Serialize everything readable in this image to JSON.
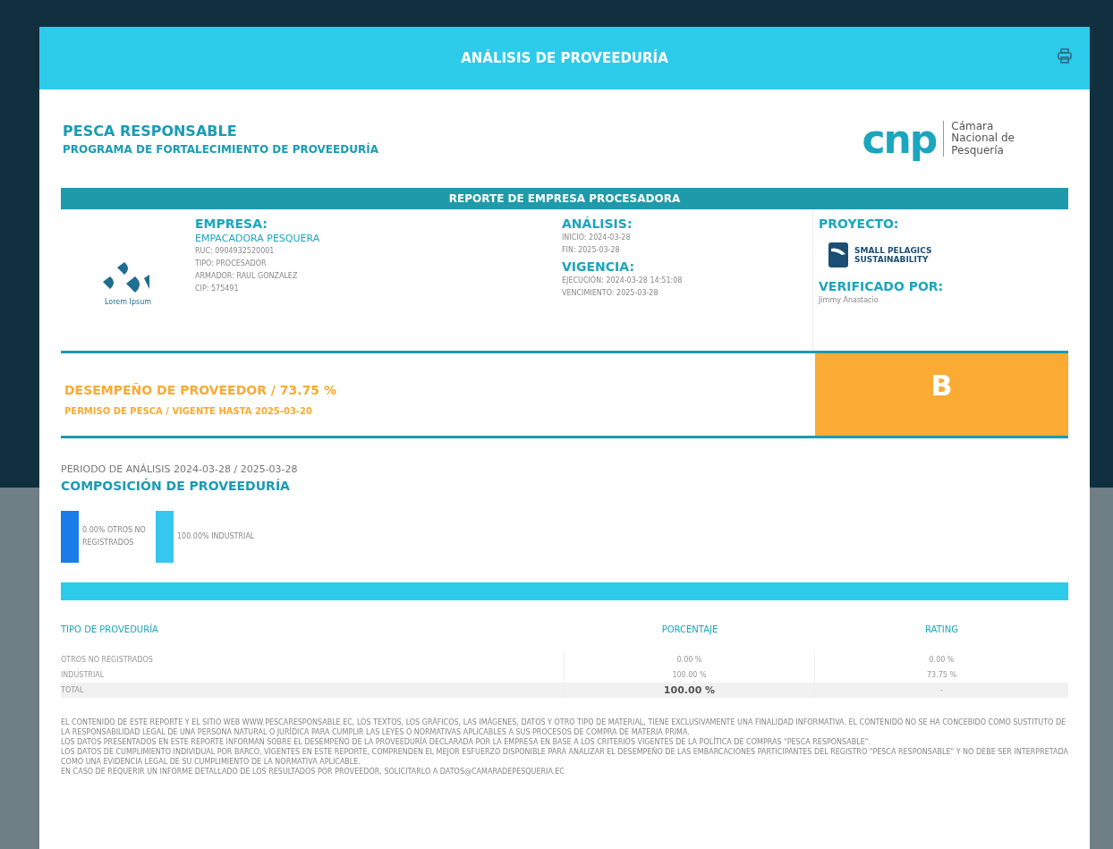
{
  "modal": {
    "title": "ANÁLISIS DE PROVEEDURÍA"
  },
  "header": {
    "title": "PESCA RESPONSABLE",
    "subtitle": "PROGRAMA DE FORTALECIMIENTO DE PROVEEDURÍA",
    "logo": {
      "mark": "cnp",
      "lines": [
        "Cámara",
        "Nacional de",
        "Pesquería"
      ]
    }
  },
  "report": {
    "title": "REPORTE DE EMPRESA PROCESADORA",
    "company_logo_text": "Lorem Ipsum",
    "empresa": {
      "heading": "EMPRESA:",
      "name": "EMPACADORA PESQUERA",
      "lines": [
        "RUC: 0904932520001",
        "TIPO: PROCESADOR",
        "ARMADOR: RAUL GONZALEZ",
        "CIP: 575491"
      ]
    },
    "analisis": {
      "heading": "ANÁLISIS:",
      "lines": [
        "INICIO: 2024-03-28",
        "FIN: 2025-03-28"
      ]
    },
    "vigencia": {
      "heading": "VIGENCIA:",
      "lines": [
        "EJECUCIÓN: 2024-03-28 14:51:08",
        "VENCIMIENTO: 2025-03-28"
      ]
    },
    "proyecto": {
      "heading": "PROYECTO:",
      "logo_lines": [
        "SMALL PELAGICS",
        "SUSTAINABILITY"
      ]
    },
    "verificado": {
      "heading": "VERIFICADO POR:",
      "name": "Jimmy Anastacio"
    }
  },
  "performance": {
    "title": "DESEMPEÑO DE PROVEEDOR / 73.75 %",
    "permit": "PERMISO DE PESCA / VIGENTE HASTA 2025-03-20",
    "grade": "B",
    "color": "#f9ab33"
  },
  "composition": {
    "period": "PERIODO DE ANÁLISIS 2024-03-28 / 2025-03-28",
    "title": "COMPOSICIÓN DE PROVEEDURÍA",
    "items": [
      {
        "label": "0.00% OTROS NO REGISTRADOS",
        "color": "#1a7de8"
      },
      {
        "label": "100.00% INDUSTRIAL",
        "color": "#36c8ef"
      }
    ]
  },
  "table": {
    "columns": [
      "TIPO DE PROVEDURÍA",
      "PORCENTAJE",
      "RATING"
    ],
    "rows": [
      {
        "kind": "normal",
        "cells": [
          "OTROS NO REGISTRADOS",
          "0.00 %",
          "0.00 %"
        ]
      },
      {
        "kind": "normal",
        "cells": [
          "INDUSTRIAL",
          "100.00 %",
          "73.75 %"
        ]
      },
      {
        "kind": "total",
        "cells": [
          "TOTAL",
          "100.00 %",
          "-"
        ]
      }
    ]
  },
  "disclaimer": [
    "EL CONTENIDO DE ESTE REPORTE Y EL SITIO WEB WWW.PESCARESPONSABLE.EC, LOS TEXTOS, LOS GRÁFICOS, LAS IMÁGENES, DATOS Y OTRO TIPO DE MATERIAL, TIENE EXCLUSIVAMENTE UNA FINALIDAD INFORMATIVA. EL CONTENIDO NO SE HA CONCEBIDO COMO SUSTITUTO DE LA RESPONSABILIDAD LEGAL DE UNA PERSONA NATURAL O JURÍDICA PARA CUMPLIR LAS LEYES O NORMATIVAS APLICABLES A SUS PROCESOS DE COMPRA DE MATERIA PRIMA.",
    "LOS DATOS PRESENTADOS EN ESTE REPORTE INFORMAN SOBRE EL DESEMPEÑO DE LA PROVEEDURÍA DECLARADA POR LA EMPRESA EN BASE A LOS CRITERIOS VIGENTES DE LA POLÍTICA DE COMPRAS \"PESCA RESPONSABLE\".",
    "LOS DATOS DE CUMPLIMIENTO INDIVIDUAL POR BARCO, VIGENTES EN ESTE REPORTE, COMPRENDEN EL MEJOR ESFUERZO DISPONIBLE PARA ANALIZAR EL DESEMPEÑO DE LAS EMBARCACIONES PARTICIPANTES DEL REGISTRO \"PESCA RESPONSABLE\" Y NO DEBE SER INTERPRETADA COMO UNA EVIDENCIA LEGAL DE SU CUMPLIMIENTO DE LA NORMATIVA APLICABLE.",
    "EN CASO DE REQUERIR UN INFORME DETALLADO DE LOS RESULTADOS POR PROVEEDOR, SOLICITARLO A DATOS@CAMARADEPESQUERIA.EC"
  ]
}
